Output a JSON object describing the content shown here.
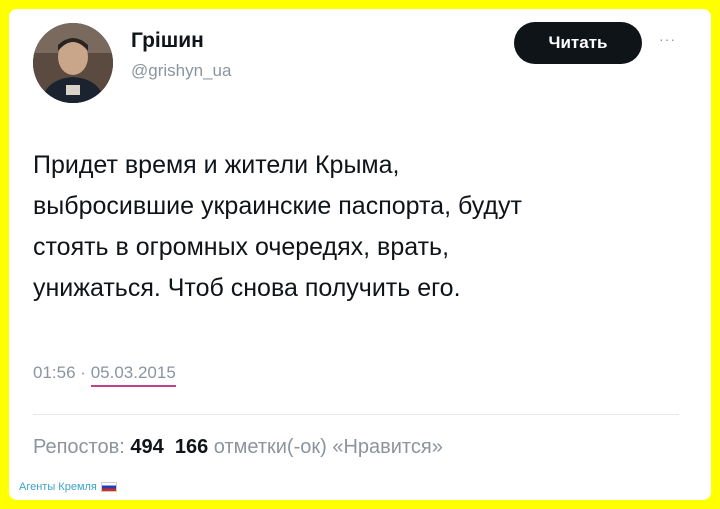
{
  "tweet": {
    "author_name": "Грішин",
    "handle": "@grishyn_ua",
    "follow_label": "Читать",
    "more_label": "···",
    "lines": [
      "Придет время и жители Крыма,",
      "выбросившие украинские паспорта, будут",
      "стоять в огромных очередях, врать,",
      "унижаться. Чтоб снова получить его."
    ],
    "time": "01:56",
    "separator": "·",
    "date": "05.03.2015",
    "reposts_label": "Репостов:",
    "reposts_count": "494",
    "likes_count": "166",
    "likes_label": "отметки(-ок) «Нравится»"
  },
  "watermark": {
    "text": "Агенты Кремля"
  },
  "colors": {
    "frame": "#ffff00",
    "button": "#0f1419",
    "muted": "#8a959e",
    "underline": "#c0428a"
  }
}
